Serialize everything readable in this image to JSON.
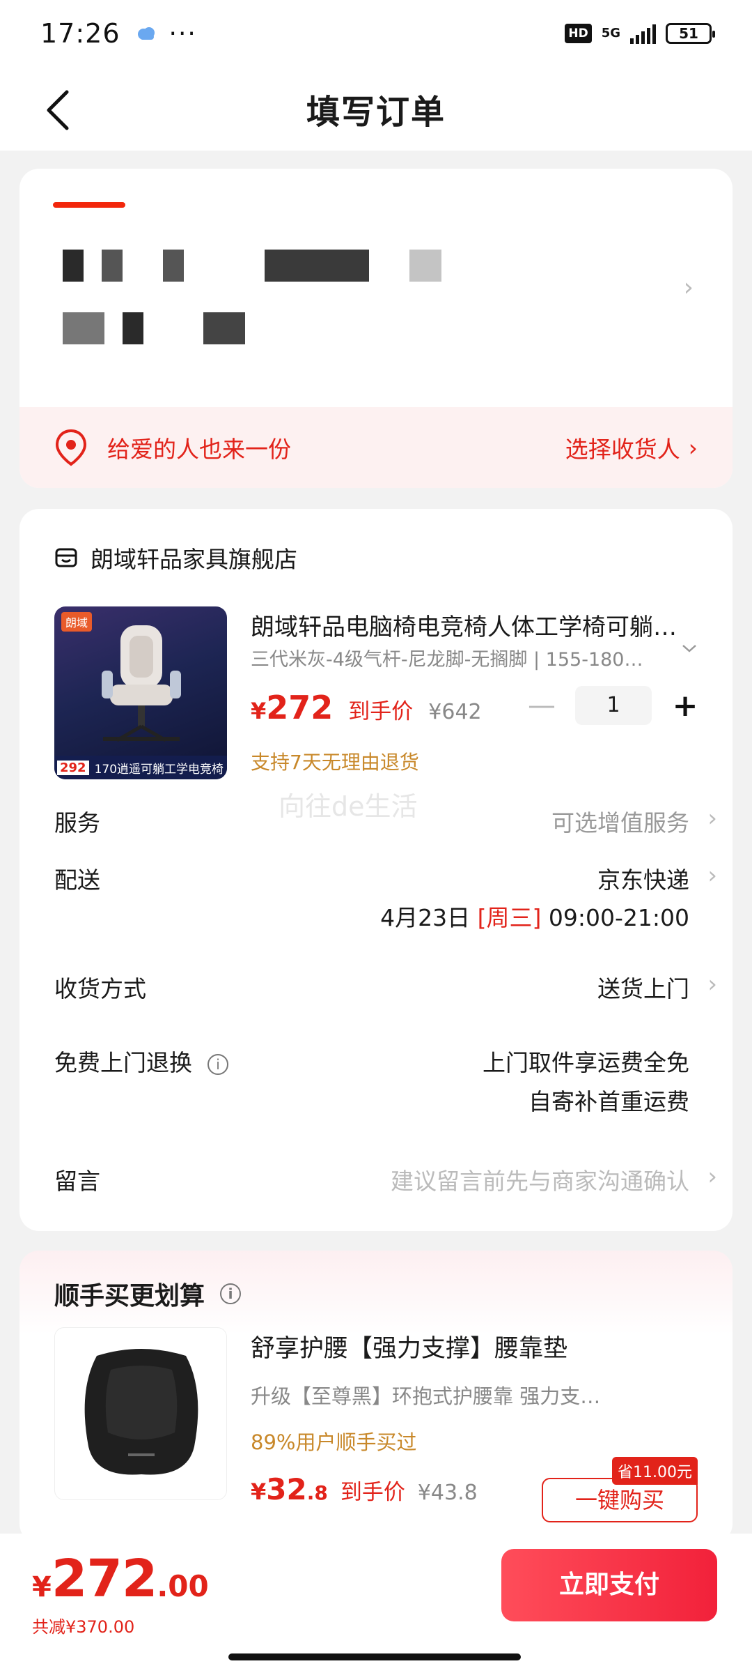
{
  "status_bar": {
    "time": "17:26",
    "dots": "···",
    "hd": "HD",
    "network": "5G",
    "battery": "51"
  },
  "header": {
    "title": "填写订单"
  },
  "address": {
    "gift_text": "给爱的人也来一份",
    "choose_receiver": "选择收货人",
    "chevron": "›"
  },
  "order": {
    "shop_name": "朗域轩品家具旗舰店",
    "product": {
      "title": "朗域轩品电脑椅电竞椅人体工学椅可躺…",
      "spec": "三代米灰-4级气杆-尼龙脚-无搁脚 | 155-180度…",
      "price_yen": "¥",
      "price": "272",
      "price_tag": "到手价",
      "original_price": "¥642",
      "quantity": "1",
      "return_policy": "支持7天无理由退货",
      "image_brand": "朗域",
      "image_caption": "170逍遥可躺工学电竞椅",
      "image_price": "292"
    },
    "watermark": "向往de生活",
    "rows": {
      "service_label": "服务",
      "service_value": "可选增值服务",
      "delivery_label": "配送",
      "delivery_value": "京东快递",
      "delivery_date": "4月23日",
      "delivery_weekday": "[周三]",
      "delivery_time": "09:00-21:00",
      "receive_label": "收货方式",
      "receive_value": "送货上门",
      "free_return_label": "免费上门退换",
      "free_return_line1": "上门取件享运费全免",
      "free_return_line2": "自寄补首重运费",
      "message_label": "留言",
      "message_placeholder": "建议留言前先与商家沟通确认"
    }
  },
  "upsell": {
    "title": "顺手买更划算",
    "product_title": "舒享护腰【强力支撑】腰靠垫",
    "product_sub": "升级【至尊黑】环抱式护腰靠   强力支…",
    "percent_text": "89%用户顺手买过",
    "price_yen": "¥",
    "price_int": "32",
    "price_dec": ".8",
    "price_tag": "到手价",
    "original_price": "¥43.8",
    "save_badge": "省11.00元",
    "buy_button": "一键购买"
  },
  "bottom_bar": {
    "total_yen": "¥",
    "total_int": "272",
    "total_dec": ".00",
    "discount_text": "共减¥370.00",
    "pay_button": "立即支付"
  },
  "colors": {
    "accent_red": "#e2231a",
    "gold": "#c8882a"
  }
}
